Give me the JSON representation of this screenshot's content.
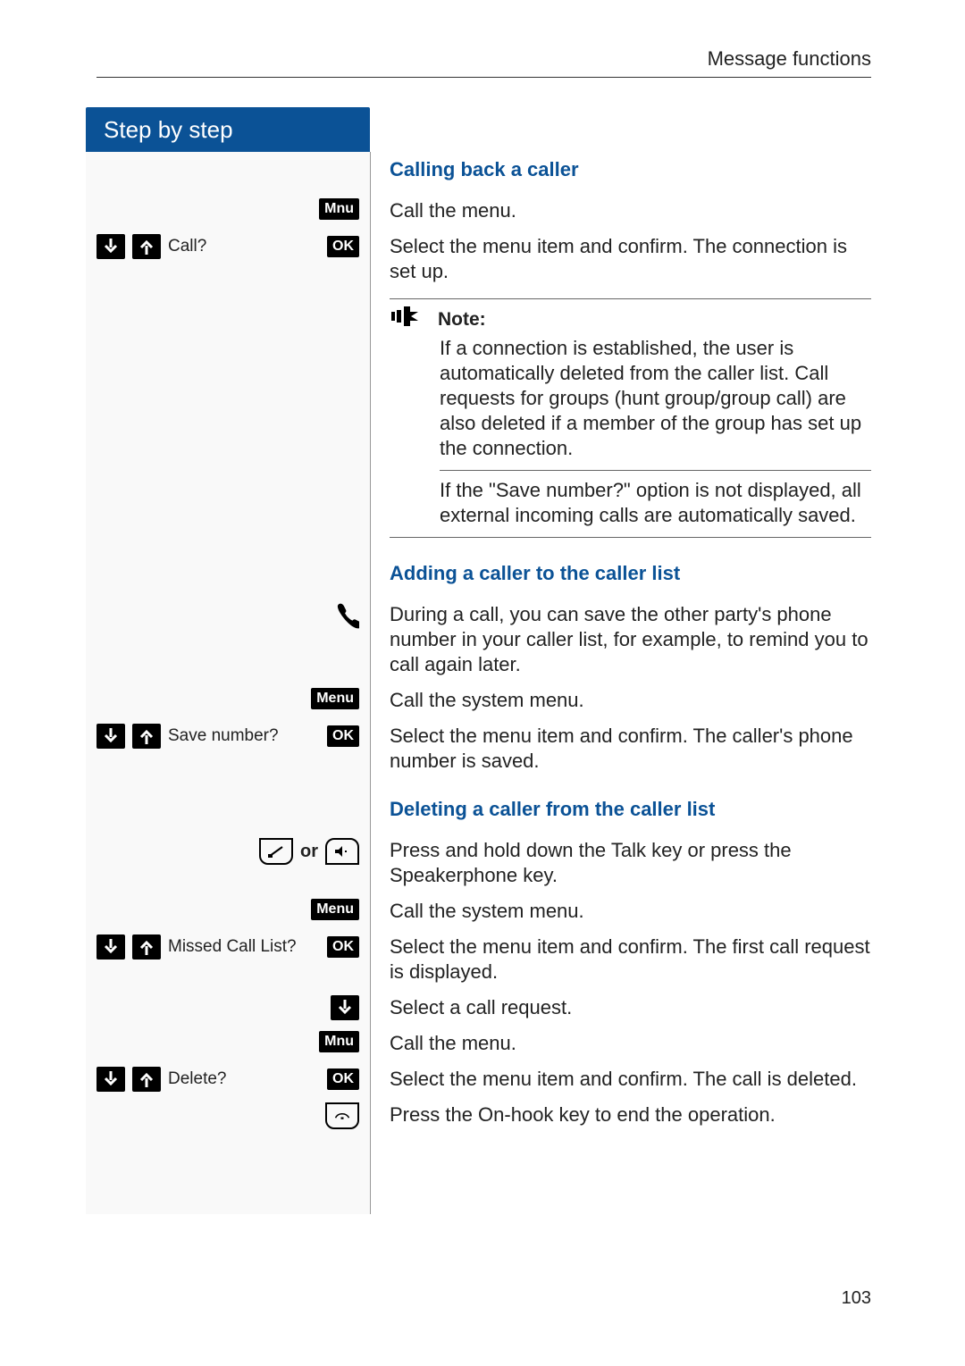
{
  "header": {
    "running": "Message functions"
  },
  "step_tab": "Step by step",
  "page_number": "103",
  "headings": {
    "h1": "Calling back a caller",
    "h2": "Adding a caller to the caller list",
    "h3": "Deleting a caller from the caller list"
  },
  "keys": {
    "mnu": "Mnu",
    "menu": "Menu",
    "ok": "OK",
    "or": "or"
  },
  "labels": {
    "call": "Call?",
    "save": "Save number?",
    "missed": "Missed Call List?",
    "delete": "Delete?"
  },
  "text": {
    "call_menu": "Call the menu.",
    "select_confirm": "Select the menu item and confirm. The connection is set up.",
    "during_call": "During a call, you can save the other party's phone number in your caller list, for example, to remind you to call again later.",
    "call_sysmenu": "Call the system menu.",
    "select_save": "Select the menu item and confirm. The caller's phone number is saved.",
    "press_talk": "Press and hold down the Talk key or press the Speakerphone key.",
    "select_first": "Select the menu item and confirm. The first call request is displayed.",
    "select_callreq": "Select a call request.",
    "select_delete": "Select the menu item and confirm. The call is deleted.",
    "press_onhook": "Press the On-hook key to end the operation."
  },
  "note": {
    "title": "Note:",
    "p1": "If a connection is established, the user is automatically deleted from the caller list. Call requests for groups (hunt group/group call) are also deleted if a member of the group has set up the connection.",
    "p2": "If the \"Save number?\" option is not displayed, all external incoming calls are automatically saved."
  }
}
